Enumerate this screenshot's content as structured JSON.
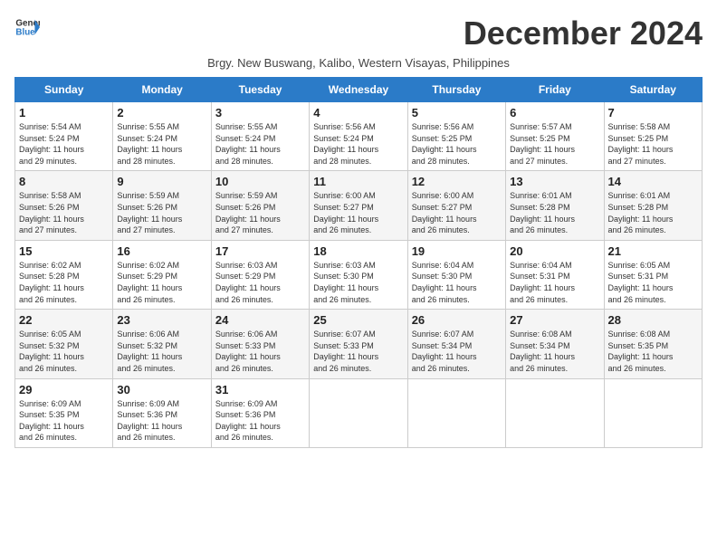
{
  "header": {
    "logo_line1": "General",
    "logo_line2": "Blue",
    "month_title": "December 2024",
    "subtitle": "Brgy. New Buswang, Kalibo, Western Visayas, Philippines"
  },
  "weekdays": [
    "Sunday",
    "Monday",
    "Tuesday",
    "Wednesday",
    "Thursday",
    "Friday",
    "Saturday"
  ],
  "weeks": [
    [
      {
        "day": "1",
        "sunrise": "5:54 AM",
        "sunset": "5:24 PM",
        "daylight": "11 hours and 29 minutes."
      },
      {
        "day": "2",
        "sunrise": "5:55 AM",
        "sunset": "5:24 PM",
        "daylight": "11 hours and 28 minutes."
      },
      {
        "day": "3",
        "sunrise": "5:55 AM",
        "sunset": "5:24 PM",
        "daylight": "11 hours and 28 minutes."
      },
      {
        "day": "4",
        "sunrise": "5:56 AM",
        "sunset": "5:24 PM",
        "daylight": "11 hours and 28 minutes."
      },
      {
        "day": "5",
        "sunrise": "5:56 AM",
        "sunset": "5:25 PM",
        "daylight": "11 hours and 28 minutes."
      },
      {
        "day": "6",
        "sunrise": "5:57 AM",
        "sunset": "5:25 PM",
        "daylight": "11 hours and 27 minutes."
      },
      {
        "day": "7",
        "sunrise": "5:58 AM",
        "sunset": "5:25 PM",
        "daylight": "11 hours and 27 minutes."
      }
    ],
    [
      {
        "day": "8",
        "sunrise": "5:58 AM",
        "sunset": "5:26 PM",
        "daylight": "11 hours and 27 minutes."
      },
      {
        "day": "9",
        "sunrise": "5:59 AM",
        "sunset": "5:26 PM",
        "daylight": "11 hours and 27 minutes."
      },
      {
        "day": "10",
        "sunrise": "5:59 AM",
        "sunset": "5:26 PM",
        "daylight": "11 hours and 27 minutes."
      },
      {
        "day": "11",
        "sunrise": "6:00 AM",
        "sunset": "5:27 PM",
        "daylight": "11 hours and 26 minutes."
      },
      {
        "day": "12",
        "sunrise": "6:00 AM",
        "sunset": "5:27 PM",
        "daylight": "11 hours and 26 minutes."
      },
      {
        "day": "13",
        "sunrise": "6:01 AM",
        "sunset": "5:28 PM",
        "daylight": "11 hours and 26 minutes."
      },
      {
        "day": "14",
        "sunrise": "6:01 AM",
        "sunset": "5:28 PM",
        "daylight": "11 hours and 26 minutes."
      }
    ],
    [
      {
        "day": "15",
        "sunrise": "6:02 AM",
        "sunset": "5:28 PM",
        "daylight": "11 hours and 26 minutes."
      },
      {
        "day": "16",
        "sunrise": "6:02 AM",
        "sunset": "5:29 PM",
        "daylight": "11 hours and 26 minutes."
      },
      {
        "day": "17",
        "sunrise": "6:03 AM",
        "sunset": "5:29 PM",
        "daylight": "11 hours and 26 minutes."
      },
      {
        "day": "18",
        "sunrise": "6:03 AM",
        "sunset": "5:30 PM",
        "daylight": "11 hours and 26 minutes."
      },
      {
        "day": "19",
        "sunrise": "6:04 AM",
        "sunset": "5:30 PM",
        "daylight": "11 hours and 26 minutes."
      },
      {
        "day": "20",
        "sunrise": "6:04 AM",
        "sunset": "5:31 PM",
        "daylight": "11 hours and 26 minutes."
      },
      {
        "day": "21",
        "sunrise": "6:05 AM",
        "sunset": "5:31 PM",
        "daylight": "11 hours and 26 minutes."
      }
    ],
    [
      {
        "day": "22",
        "sunrise": "6:05 AM",
        "sunset": "5:32 PM",
        "daylight": "11 hours and 26 minutes."
      },
      {
        "day": "23",
        "sunrise": "6:06 AM",
        "sunset": "5:32 PM",
        "daylight": "11 hours and 26 minutes."
      },
      {
        "day": "24",
        "sunrise": "6:06 AM",
        "sunset": "5:33 PM",
        "daylight": "11 hours and 26 minutes."
      },
      {
        "day": "25",
        "sunrise": "6:07 AM",
        "sunset": "5:33 PM",
        "daylight": "11 hours and 26 minutes."
      },
      {
        "day": "26",
        "sunrise": "6:07 AM",
        "sunset": "5:34 PM",
        "daylight": "11 hours and 26 minutes."
      },
      {
        "day": "27",
        "sunrise": "6:08 AM",
        "sunset": "5:34 PM",
        "daylight": "11 hours and 26 minutes."
      },
      {
        "day": "28",
        "sunrise": "6:08 AM",
        "sunset": "5:35 PM",
        "daylight": "11 hours and 26 minutes."
      }
    ],
    [
      {
        "day": "29",
        "sunrise": "6:09 AM",
        "sunset": "5:35 PM",
        "daylight": "11 hours and 26 minutes."
      },
      {
        "day": "30",
        "sunrise": "6:09 AM",
        "sunset": "5:36 PM",
        "daylight": "11 hours and 26 minutes."
      },
      {
        "day": "31",
        "sunrise": "6:09 AM",
        "sunset": "5:36 PM",
        "daylight": "11 hours and 26 minutes."
      },
      null,
      null,
      null,
      null
    ]
  ],
  "labels": {
    "sunrise": "Sunrise:",
    "sunset": "Sunset:",
    "daylight": "Daylight:"
  }
}
